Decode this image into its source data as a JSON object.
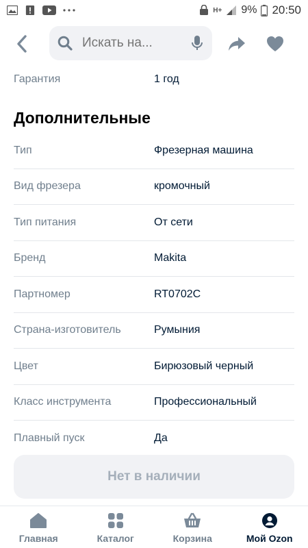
{
  "status_bar": {
    "battery": "9%",
    "time": "20:50",
    "network": "H+"
  },
  "search": {
    "placeholder": "Искать на..."
  },
  "warranty": {
    "key": "Гарантия",
    "value": "1 год"
  },
  "section": {
    "title": "Дополнительные"
  },
  "specs": [
    {
      "key": "Тип",
      "value": "Фрезерная машина"
    },
    {
      "key": "Вид фрезера",
      "value": "кромочный"
    },
    {
      "key": "Тип питания",
      "value": "От сети"
    },
    {
      "key": "Бренд",
      "value": "Makita"
    },
    {
      "key": "Партномер",
      "value": "RT0702C"
    },
    {
      "key": "Страна-изготовитель",
      "value": "Румыния"
    },
    {
      "key": "Цвет",
      "value": "Бирюзовый черный"
    },
    {
      "key": "Класс инструмента",
      "value": "Профессиональный"
    },
    {
      "key": "Плавный пуск",
      "value": "Да"
    }
  ],
  "buy_button": {
    "label": "Нет в наличии"
  },
  "bottom_nav": {
    "items": [
      {
        "label": "Главная",
        "icon": "home-icon"
      },
      {
        "label": "Каталог",
        "icon": "catalog-icon"
      },
      {
        "label": "Корзина",
        "icon": "cart-icon"
      },
      {
        "label": "Мой Ozon",
        "icon": "profile-icon"
      }
    ]
  },
  "colors": {
    "accent_blue": "#005bff",
    "text_primary": "#001a34",
    "text_secondary": "#707f8d",
    "button_bg": "#f1f2f5"
  }
}
